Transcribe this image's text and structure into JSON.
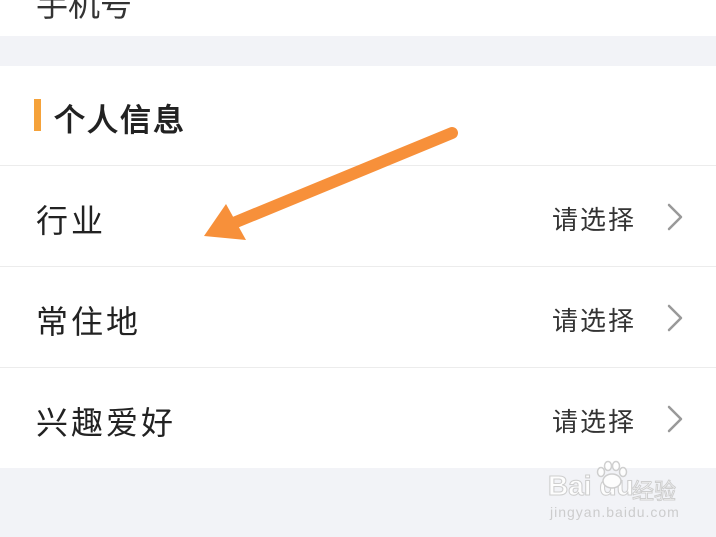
{
  "top_partial": {
    "text": "手机号"
  },
  "section": {
    "title": "个人信息",
    "accent_color": "#f5a23a"
  },
  "rows": [
    {
      "label": "行业",
      "value": "请选择",
      "icon": "chevron-right-icon"
    },
    {
      "label": "常住地",
      "value": "请选择",
      "icon": "chevron-right-icon"
    },
    {
      "label": "兴趣爱好",
      "value": "请选择",
      "icon": "chevron-right-icon"
    }
  ],
  "annotation": {
    "color": "#f7903a",
    "icon": "arrow-annotation"
  },
  "watermark": {
    "logo": "Bai  du",
    "brand": "经验",
    "url": "jingyan.baidu.com"
  }
}
